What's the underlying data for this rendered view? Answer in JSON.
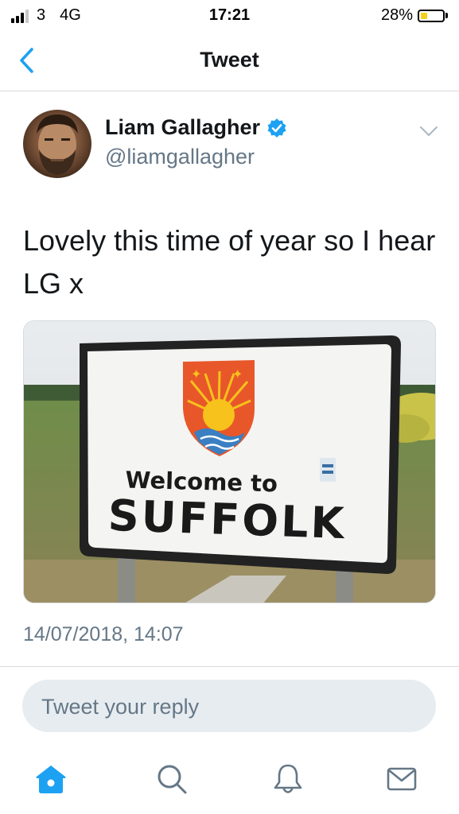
{
  "status_bar": {
    "carrier": "3",
    "network": "4G",
    "time": "17:21",
    "battery_percent": "28%",
    "battery_level": 0.28,
    "battery_color": "#f4cf1b"
  },
  "nav": {
    "title": "Tweet",
    "back_icon": "chevron-left-icon",
    "accent_color": "#1da1f2"
  },
  "tweet": {
    "author_name": "Liam Gallagher",
    "author_handle": "@liamgallagher",
    "verified": true,
    "text": "Lovely this time of year so I hear LG x",
    "timestamp": "14/07/2018, 14:07",
    "media": {
      "sign_line1": "Welcome to",
      "sign_line2": "SUFFOLK"
    }
  },
  "reply": {
    "placeholder": "Tweet your reply"
  },
  "tab_bar": {
    "items": [
      {
        "icon": "home-icon",
        "active": true
      },
      {
        "icon": "search-icon",
        "active": false
      },
      {
        "icon": "notifications-bell-icon",
        "active": false
      },
      {
        "icon": "messages-envelope-icon",
        "active": false
      }
    ]
  }
}
